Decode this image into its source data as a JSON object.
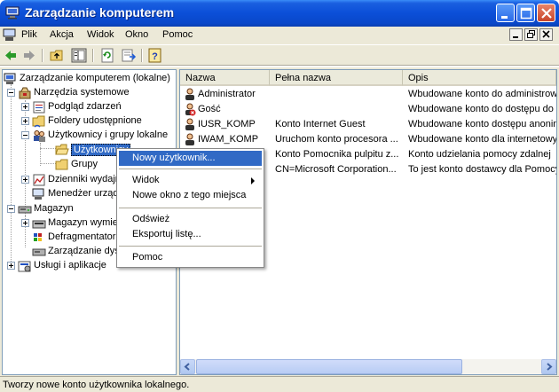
{
  "window": {
    "title": "Zarządzanie komputerem"
  },
  "menubar": {
    "items": [
      "Plik",
      "Akcja",
      "Widok",
      "Okno",
      "Pomoc"
    ]
  },
  "tree": {
    "nodes": [
      "Zarządzanie komputerem (lokalne)",
      "Narzędzia systemowe",
      "Podgląd zdarzeń",
      "Foldery udostępnione",
      "Użytkownicy i grupy lokalne",
      "Użytkownicy",
      "Grupy",
      "Dzienniki wydajności i alerty",
      "Menedżer urządzeń",
      "Magazyn",
      "Magazyn wymienny",
      "Defragmentator dysków",
      "Zarządzanie dyskami",
      "Usługi i aplikacje"
    ]
  },
  "list": {
    "columns": [
      "Nazwa",
      "Pełna nazwa",
      "Opis"
    ],
    "rows": [
      {
        "name": "Administrator",
        "full_name": "",
        "description": "Wbudowane konto do administrowania",
        "disabled": false
      },
      {
        "name": "Gość",
        "full_name": "",
        "description": "Wbudowane konto do dostępu do k",
        "disabled": true
      },
      {
        "name": "IUSR_KOMP",
        "full_name": "Konto Internet Guest",
        "description": "Wbudowane konto dostępu anonim",
        "disabled": false
      },
      {
        "name": "IWAM_KOMP",
        "full_name": "Uruchom konto procesora ...",
        "description": "Wbudowane konto dla internetowy",
        "disabled": false
      },
      {
        "name": "",
        "full_name": "Konto Pomocnika pulpitu z...",
        "description": "Konto udzielania pomocy zdalnej",
        "disabled": true
      },
      {
        "name": "",
        "full_name": "CN=Microsoft Corporation...",
        "description": "To jest konto dostawcy dla Pomocy",
        "disabled": false
      }
    ]
  },
  "context_menu": {
    "items": [
      {
        "label": "Nowy użytkownik...",
        "highlighted": true,
        "submenu": false
      },
      {
        "label": "Widok",
        "highlighted": false,
        "submenu": true
      },
      {
        "label": "Nowe okno z tego miejsca",
        "highlighted": false,
        "submenu": false
      },
      {
        "label": "Odśwież",
        "highlighted": false,
        "submenu": false
      },
      {
        "label": "Eksportuj listę...",
        "highlighted": false,
        "submenu": false
      },
      {
        "label": "Pomoc",
        "highlighted": false,
        "submenu": false
      }
    ]
  },
  "statusbar": {
    "text": "Tworzy nowe konto użytkownika lokalnego."
  },
  "colors": {
    "titlebar": "#0b4fd8",
    "selection": "#316ac5",
    "chrome": "#ece9d8"
  }
}
